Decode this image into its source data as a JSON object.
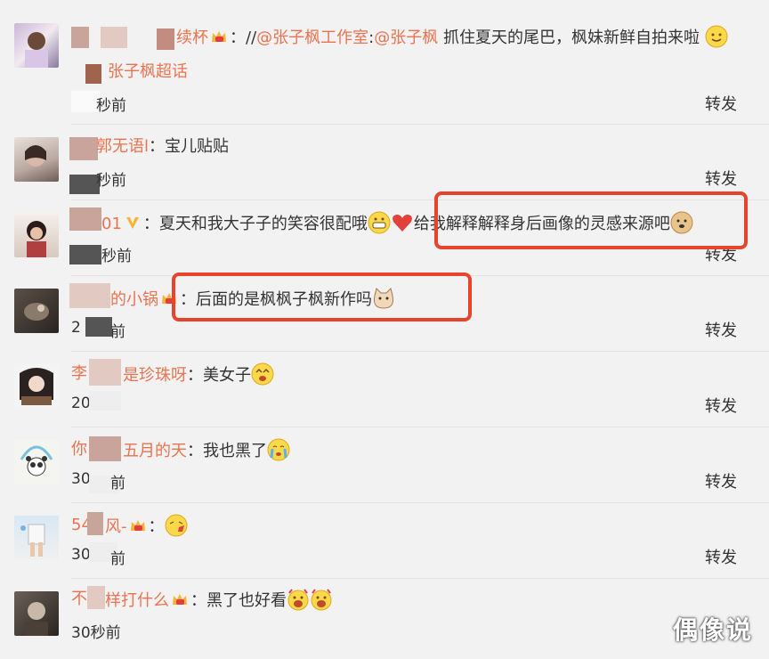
{
  "comments": [
    {
      "user": "续杯",
      "text_parts": [
        "：//",
        "@张子枫工作室",
        ":",
        "@张子枫",
        "  抓住夏天的尾巴，枫妹新鲜自拍来啦"
      ],
      "line2": "张子枫超话",
      "time": "秒前",
      "action": "转发"
    },
    {
      "user": "郭无语l",
      "text": "：宝儿贴贴",
      "time": "秒前",
      "action": "转发"
    },
    {
      "user": "01",
      "text": "：夏天和我大子子的笑容很配哦",
      "highlight_text": "给我解释解释身后画像的灵感来源吧",
      "time": "秒前",
      "action": "转发"
    },
    {
      "user": "的小锅",
      "text": "：后面的是枫枫子枫新作吗",
      "time": "2",
      "time_suffix": "前",
      "action": "转发"
    },
    {
      "user_a": "李",
      "user_b": "是珍珠呀",
      "text": "：美女子",
      "time": "20",
      "action": "转发"
    },
    {
      "user_a": "你",
      "user_b": "五月的天",
      "text": "：我也黑了",
      "time": "30",
      "time_suffix": "前",
      "action": "转发"
    },
    {
      "user_a": "54",
      "user_b": "风-",
      "text": "：",
      "time": "30",
      "time_suffix": "前",
      "action": "转发"
    },
    {
      "user_a": "不",
      "user_b": "样打什么",
      "text": "：黑了也好看",
      "time": "30秒前"
    }
  ],
  "watermark": "偶像说",
  "colors": {
    "username": "#eb7350",
    "highlight": "#e8432d",
    "background": "#f2f2f2"
  }
}
